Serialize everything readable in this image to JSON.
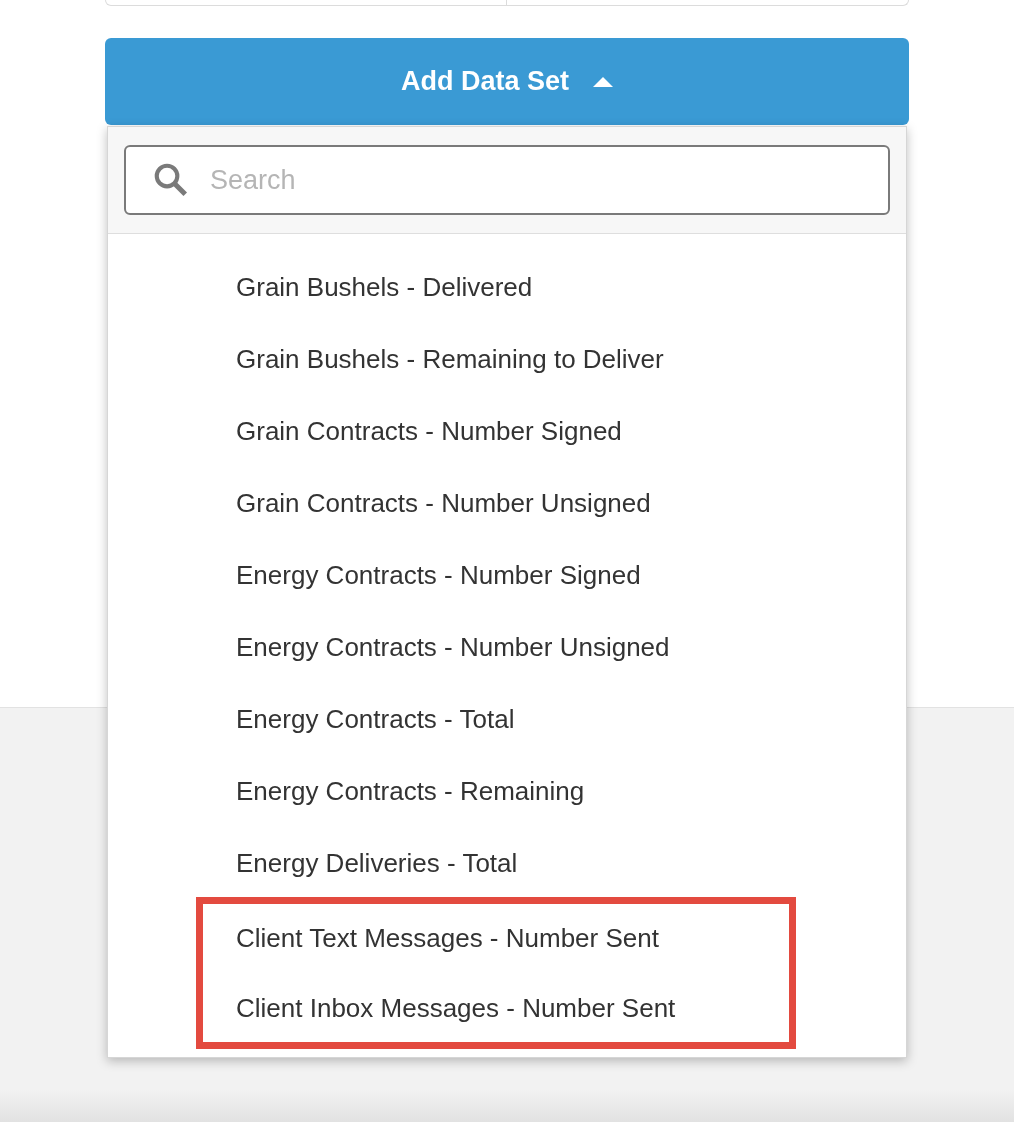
{
  "add_button": {
    "label": "Add Data Set",
    "expanded": true
  },
  "dropdown": {
    "search": {
      "placeholder": "Search"
    },
    "items": [
      {
        "label": "Grain Bushels - Delivered",
        "highlighted": false
      },
      {
        "label": "Grain Bushels - Remaining to Deliver",
        "highlighted": false
      },
      {
        "label": "Grain Contracts - Number Signed",
        "highlighted": false
      },
      {
        "label": "Grain Contracts - Number Unsigned",
        "highlighted": false
      },
      {
        "label": "Energy Contracts - Number Signed",
        "highlighted": false
      },
      {
        "label": "Energy Contracts - Number Unsigned",
        "highlighted": false
      },
      {
        "label": "Energy Contracts - Total",
        "highlighted": false
      },
      {
        "label": "Energy Contracts - Remaining",
        "highlighted": false
      },
      {
        "label": "Energy Deliveries - Total",
        "highlighted": false
      },
      {
        "label": "Client Text Messages - Number Sent",
        "highlighted": true
      },
      {
        "label": "Client Inbox Messages - Number Sent",
        "highlighted": true
      }
    ]
  }
}
